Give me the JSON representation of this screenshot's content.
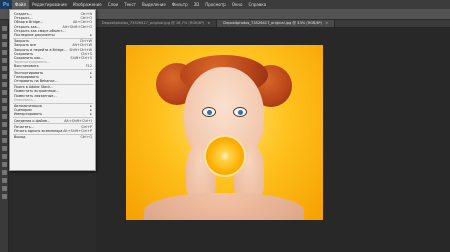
{
  "app": {
    "logo_label": "Ps"
  },
  "menubar": {
    "items": [
      "Файл",
      "Редактирование",
      "Изображение",
      "Слои",
      "Текст",
      "Выделение",
      "Фильтр",
      "3D",
      "Просмотр",
      "Окно",
      "Справка"
    ]
  },
  "tabs": [
    {
      "label": "Depositphotos_73526417_original.jpg @ 16,7% (RGB/8*)",
      "active": false
    },
    {
      "label": "Depositphotos_73526417_original.jpg @ 33% (RGB/8*)",
      "active": true
    }
  ],
  "tab_close_glyph": "×",
  "file_menu": {
    "groups": [
      [
        {
          "label": "Создать...",
          "shortcut": "Ctrl+N"
        },
        {
          "label": "Открыть...",
          "shortcut": "Ctrl+O"
        },
        {
          "label": "Обзор в Bridge...",
          "shortcut": "Alt+Ctrl+O"
        },
        {
          "label": "Открыть как...",
          "shortcut": "Alt+Shift+Ctrl+O"
        },
        {
          "label": "Открыть как смарт-объект..."
        },
        {
          "label": "Последние документы",
          "submenu": true
        }
      ],
      [
        {
          "label": "Закрыть",
          "shortcut": "Ctrl+W"
        },
        {
          "label": "Закрыть все",
          "shortcut": "Alt+Ctrl+W"
        },
        {
          "label": "Закрыть и перейти в Bridge...",
          "shortcut": "Shift+Ctrl+W"
        },
        {
          "label": "Сохранить",
          "shortcut": "Ctrl+S"
        },
        {
          "label": "Сохранить как...",
          "shortcut": "Shift+Ctrl+S"
        },
        {
          "label": "Зарегистрировать...",
          "disabled": true
        },
        {
          "label": "Восстановить",
          "shortcut": "F12"
        }
      ],
      [
        {
          "label": "Экспортировать",
          "submenu": true
        },
        {
          "label": "Генерировать",
          "submenu": true
        },
        {
          "label": "Отправить на Behance..."
        }
      ],
      [
        {
          "label": "Поиск в Adobe Stock..."
        },
        {
          "label": "Поместить встроенные..."
        },
        {
          "label": "Поместить связанные..."
        },
        {
          "label": "Упаковать...",
          "disabled": true
        }
      ],
      [
        {
          "label": "Автоматизация",
          "submenu": true
        },
        {
          "label": "Сценарии",
          "submenu": true
        },
        {
          "label": "Импортировать",
          "submenu": true
        }
      ],
      [
        {
          "label": "Сведения о файле...",
          "shortcut": "Alt+Shift+Ctrl+I"
        }
      ],
      [
        {
          "label": "Печатать...",
          "shortcut": "Ctrl+P"
        },
        {
          "label": "Печать одного экземпляра",
          "shortcut": "Alt+Shift+Ctrl+P"
        }
      ],
      [
        {
          "label": "Выход",
          "shortcut": "Ctrl+Q"
        }
      ]
    ]
  },
  "colors": {
    "menubar": "#3c3c3c",
    "workspace": "#2b2b2b",
    "menu_bg": "#f2f2f2",
    "photo_background": "#ffc21e"
  }
}
